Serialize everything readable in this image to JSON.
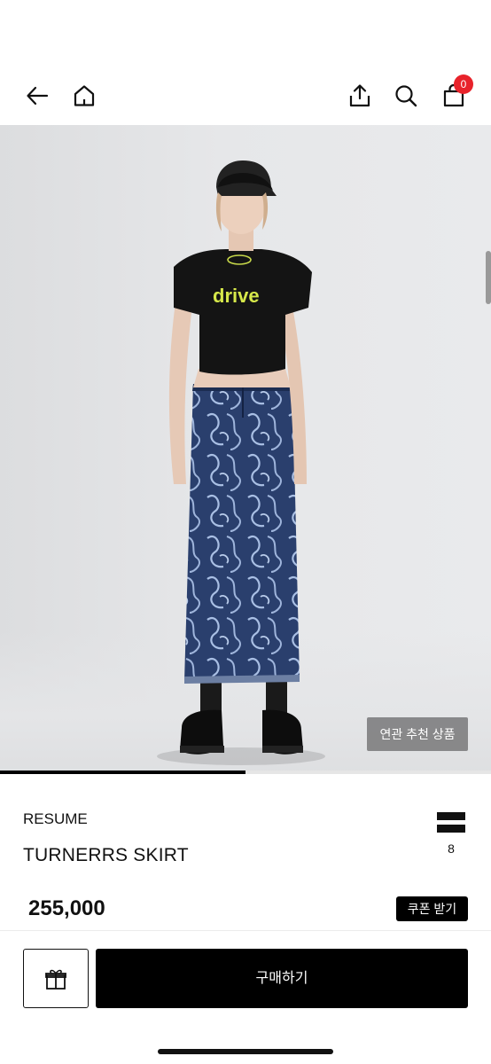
{
  "header": {
    "back_icon": "arrow-left-icon",
    "home_icon": "home-icon",
    "share_icon": "share-icon",
    "search_icon": "search-icon",
    "cart_icon": "shopping-bag-icon",
    "cart_count": "0"
  },
  "gallery": {
    "related_label": "연관 추천 상품",
    "progress": 0.5
  },
  "product": {
    "brand": "RESUME",
    "name": "TURNERRS SKIRT",
    "list_count": "8",
    "price": "255,000",
    "coupon_label": "쿠폰 받기",
    "tee_print": "drive"
  },
  "bottom_bar": {
    "gift_icon": "gift-icon",
    "buy_label": "구매하기"
  },
  "colors": {
    "accent": "#000000",
    "badge": "#e8232b"
  }
}
